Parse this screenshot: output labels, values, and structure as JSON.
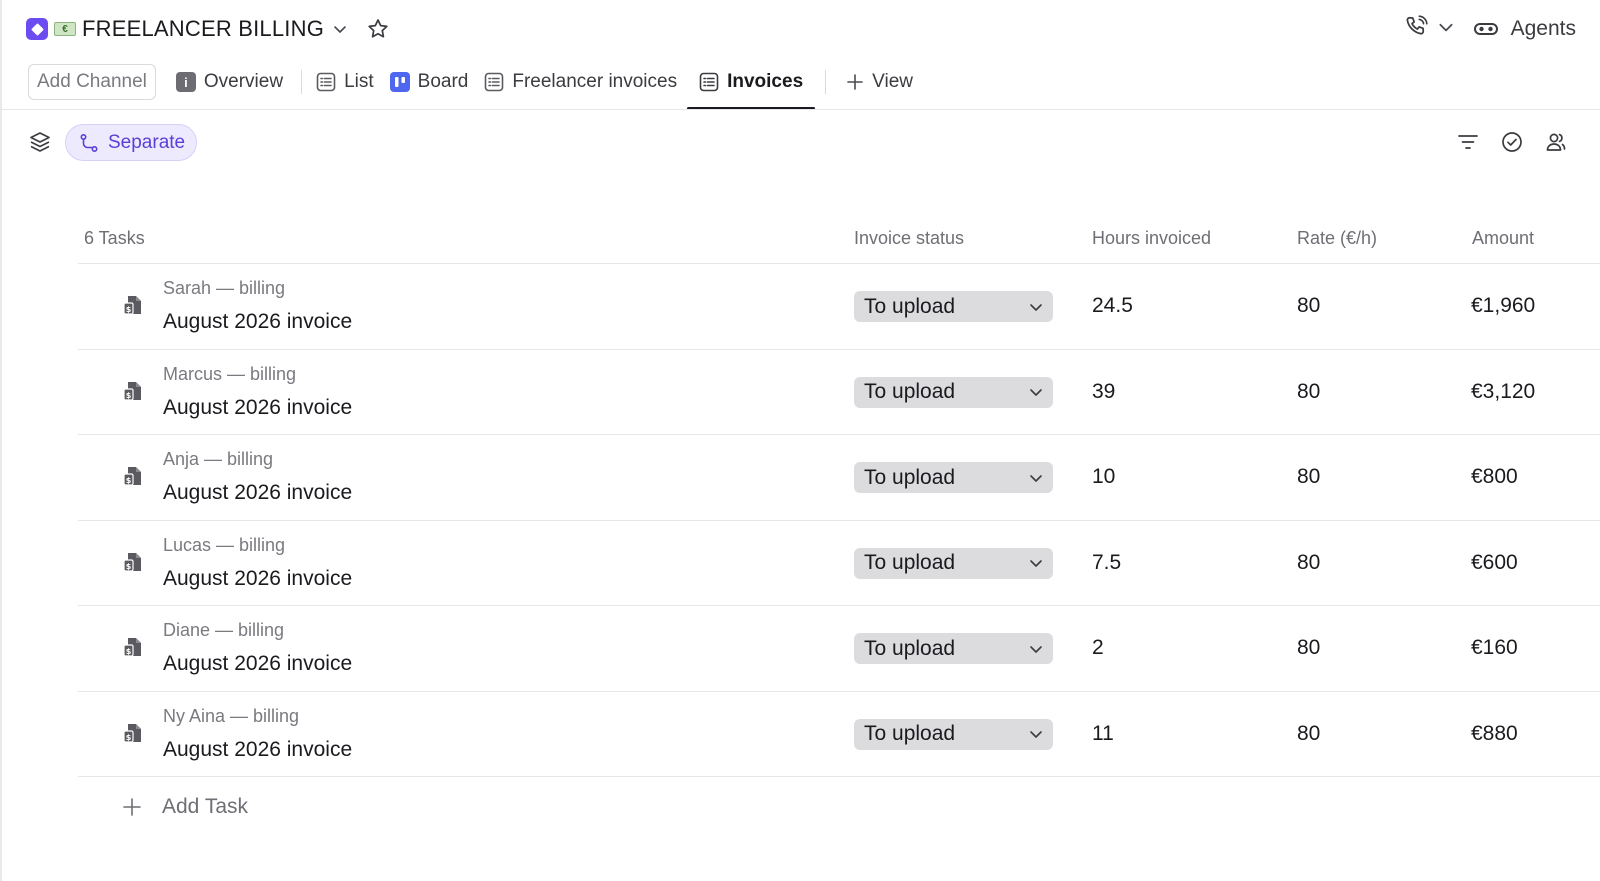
{
  "header": {
    "title": "FREELANCER BILLING",
    "emoji_text": "€",
    "agents_label": "Agents"
  },
  "tabs": {
    "add_channel": "Add Channel",
    "items": [
      {
        "label": "Overview",
        "icon": "info-doc-icon"
      },
      {
        "label": "List",
        "icon": "list-icon"
      },
      {
        "label": "Board",
        "icon": "board-icon"
      },
      {
        "label": "Freelancer invoices",
        "icon": "list-icon"
      },
      {
        "label": "Invoices",
        "icon": "list-icon",
        "active": true
      }
    ],
    "add_view": "View"
  },
  "toolbar": {
    "separate_label": "Separate"
  },
  "table": {
    "count_label": "6 Tasks",
    "columns": [
      "Invoice status",
      "Hours invoiced",
      "Rate (€/h)",
      "Amount"
    ],
    "rows": [
      {
        "subtitle": "Sarah — billing",
        "name": "August 2026 invoice",
        "status": "To upload",
        "hours": "24.5",
        "rate": "80",
        "amount": "€1,960"
      },
      {
        "subtitle": "Marcus — billing",
        "name": "August 2026 invoice",
        "status": "To upload",
        "hours": "39",
        "rate": "80",
        "amount": "€3,120"
      },
      {
        "subtitle": "Anja — billing",
        "name": "August 2026 invoice",
        "status": "To upload",
        "hours": "10",
        "rate": "80",
        "amount": "€800"
      },
      {
        "subtitle": "Lucas — billing",
        "name": "August 2026 invoice",
        "status": "To upload",
        "hours": "7.5",
        "rate": "80",
        "amount": "€600"
      },
      {
        "subtitle": "Diane — billing",
        "name": "August 2026 invoice",
        "status": "To upload",
        "hours": "2",
        "rate": "80",
        "amount": "€160"
      },
      {
        "subtitle": "Ny Aina — billing",
        "name": "August 2026 invoice",
        "status": "To upload",
        "hours": "11",
        "rate": "80",
        "amount": "€880"
      }
    ],
    "add_task_label": "Add Task"
  },
  "colors": {
    "accent": "#6c4cf1",
    "board_blue": "#4f66f0",
    "status_bg": "#dcdcdf"
  }
}
